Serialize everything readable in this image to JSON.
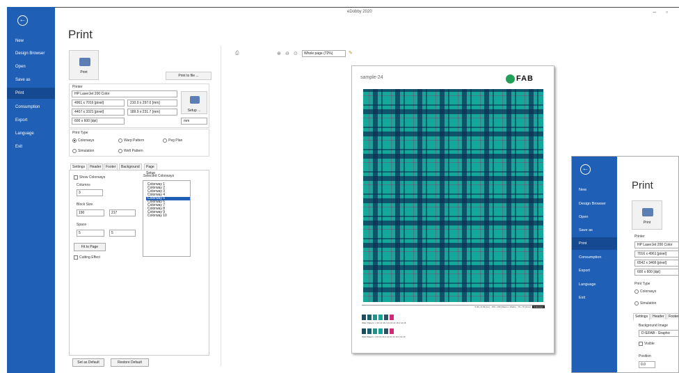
{
  "app": {
    "title": "eDobby 2020",
    "window_controls": "–  ▫"
  },
  "nav": {
    "items": [
      "New",
      "Design Browser",
      "Open",
      "Save as",
      "Print",
      "Consumption",
      "Export",
      "Language",
      "Exit"
    ],
    "active": "Print"
  },
  "main": {
    "title": "Print",
    "print_button": "Print",
    "print_to_file": "Print to file ...",
    "printer": {
      "label": "Printer",
      "name": "HP LaserJet 200 Color",
      "pixel_size": "4961 x 7016 [pixel]",
      "mm_size": "210.0 x 297.0 [mm]",
      "pixel_size2": "4407 x 3321 [pixel]",
      "mm_size2": "189.9 x 231.7 [mm]",
      "dpi": "600 x 600 [dpi]",
      "setup": "Setup ...",
      "unit": "mm"
    },
    "print_type": {
      "label": "Print Type",
      "options": [
        "Colorways",
        "Warp Pattern",
        "Peg Plan",
        "Simulation",
        "Weft Pattern"
      ],
      "selected": "Colorways"
    },
    "tabs": [
      "Settings",
      "Header",
      "Footer",
      "Background",
      "Page Setup"
    ],
    "active_tab": "Settings",
    "settings": {
      "show_colorways": "Show Colorways",
      "columns_label": "Columns",
      "columns_value": "3",
      "block_size_label": "Block Size",
      "block_w": "190",
      "block_h": "217",
      "space_label": "Space",
      "space_x": "5",
      "space_y": "5",
      "fit_to_page": "Fit to Page",
      "cutting_effect": "Cutting Effect",
      "selected_colorways_label": "Selected Colorways",
      "colorways": [
        "Colorway 1",
        "Colorway 2",
        "Colorway 3",
        "Colorway 4",
        "Colorway 5",
        "Colorway 6",
        "Colorway 7",
        "Colorway 8",
        "Colorway 9",
        "Colorway 10"
      ],
      "selected_colorway": "Colorway 5"
    },
    "set_as_default": "Set as Default",
    "restore_default": "Restore Default"
  },
  "preview": {
    "zoom": "Whole page (72%)",
    "sample_name": "sample-24",
    "logo_text": "FAB",
    "info": "5.36 x 5.09 [cm] · 153 x 155 [Warps x Wefts] · 76 x 76 [1/cm]",
    "info_badge": "Colorways",
    "warp_caption": "Warp Pattern: 1 16 14 16 2 14 16 14 16 2 14 16",
    "weft_caption": "Weft Pattern: 1 16 14 16 2 14 16 14 16 2 14 16",
    "warp_colors": [
      "#1d4e5a",
      "#1a6070",
      "#2a8e8a",
      "#17a395",
      "#2a5466",
      "#d0297a"
    ],
    "weft_colors": [
      "#1d4e5a",
      "#1a6070",
      "#2a8e8a",
      "#17a395",
      "#2a5466",
      "#d0297a"
    ]
  },
  "overlay": {
    "nav_items": [
      "New",
      "Design Browser",
      "Open",
      "Save as",
      "Print",
      "Consumption",
      "Export",
      "Language",
      "Exit"
    ],
    "title": "Print",
    "print_button": "Print",
    "printer_label": "Printer",
    "printer_name": "HP LaserJet 200 Color",
    "pixel_size": "7016 x 4961 [pixel]",
    "pixel_size2": "6542 x 3466 [pixel]",
    "dpi": "600 x 600 [dpi]",
    "print_type_label": "Print Type",
    "options": [
      "Colorways",
      "Simulation"
    ],
    "tabs": [
      "Settings",
      "Header",
      "Footer"
    ],
    "bg_image_label": "Background Image",
    "bg_path": "D:\\EFAB - Graphic",
    "visible": "Visible",
    "position_label": "Position",
    "pos_value": "0.0"
  }
}
